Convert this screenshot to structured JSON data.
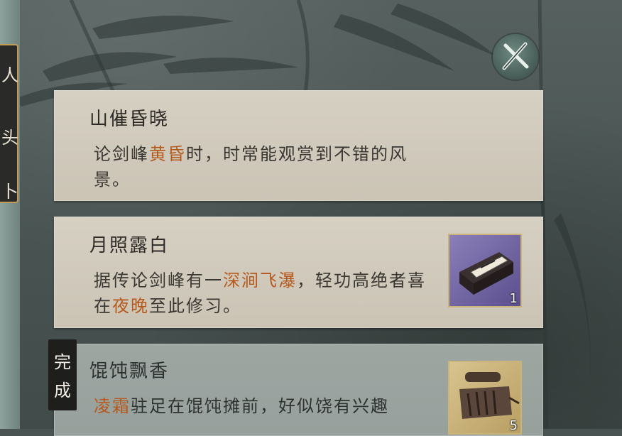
{
  "left_tab": {
    "glyphs": [
      "人",
      "头",
      "卜"
    ]
  },
  "close_button": {
    "icon": "close-x-icon"
  },
  "quests": [
    {
      "title": "山催昏晓",
      "desc_parts": [
        {
          "text": "论剑峰",
          "hl": false
        },
        {
          "text": "黄昏",
          "hl": true
        },
        {
          "text": "时，时常能观赏到不错的风景。",
          "hl": false
        }
      ],
      "has_item": false
    },
    {
      "title": "月照露白",
      "desc_parts": [
        {
          "text": "据传论剑峰有一",
          "hl": false
        },
        {
          "text": "深涧飞瀑",
          "hl": true
        },
        {
          "text": "，轻功高绝者喜在",
          "hl": false
        },
        {
          "text": "夜晚",
          "hl": true
        },
        {
          "text": "至此修习。",
          "hl": false
        }
      ],
      "has_item": true,
      "item": {
        "icon": "scroll-box-icon",
        "count": "1"
      }
    },
    {
      "title": "馄饨飘香",
      "desc_parts": [
        {
          "text": "凌霜",
          "hl": true
        },
        {
          "text": "驻足在馄饨摊前，好似饶有兴趣",
          "hl": false
        }
      ],
      "has_item": true,
      "item": {
        "icon": "leather-tool-roll-icon",
        "count": "5"
      },
      "status": "完成"
    }
  ],
  "colors": {
    "highlight": "#b5591d",
    "card_bg": "#d6d0c3",
    "accent_gold": "#c49a57"
  }
}
